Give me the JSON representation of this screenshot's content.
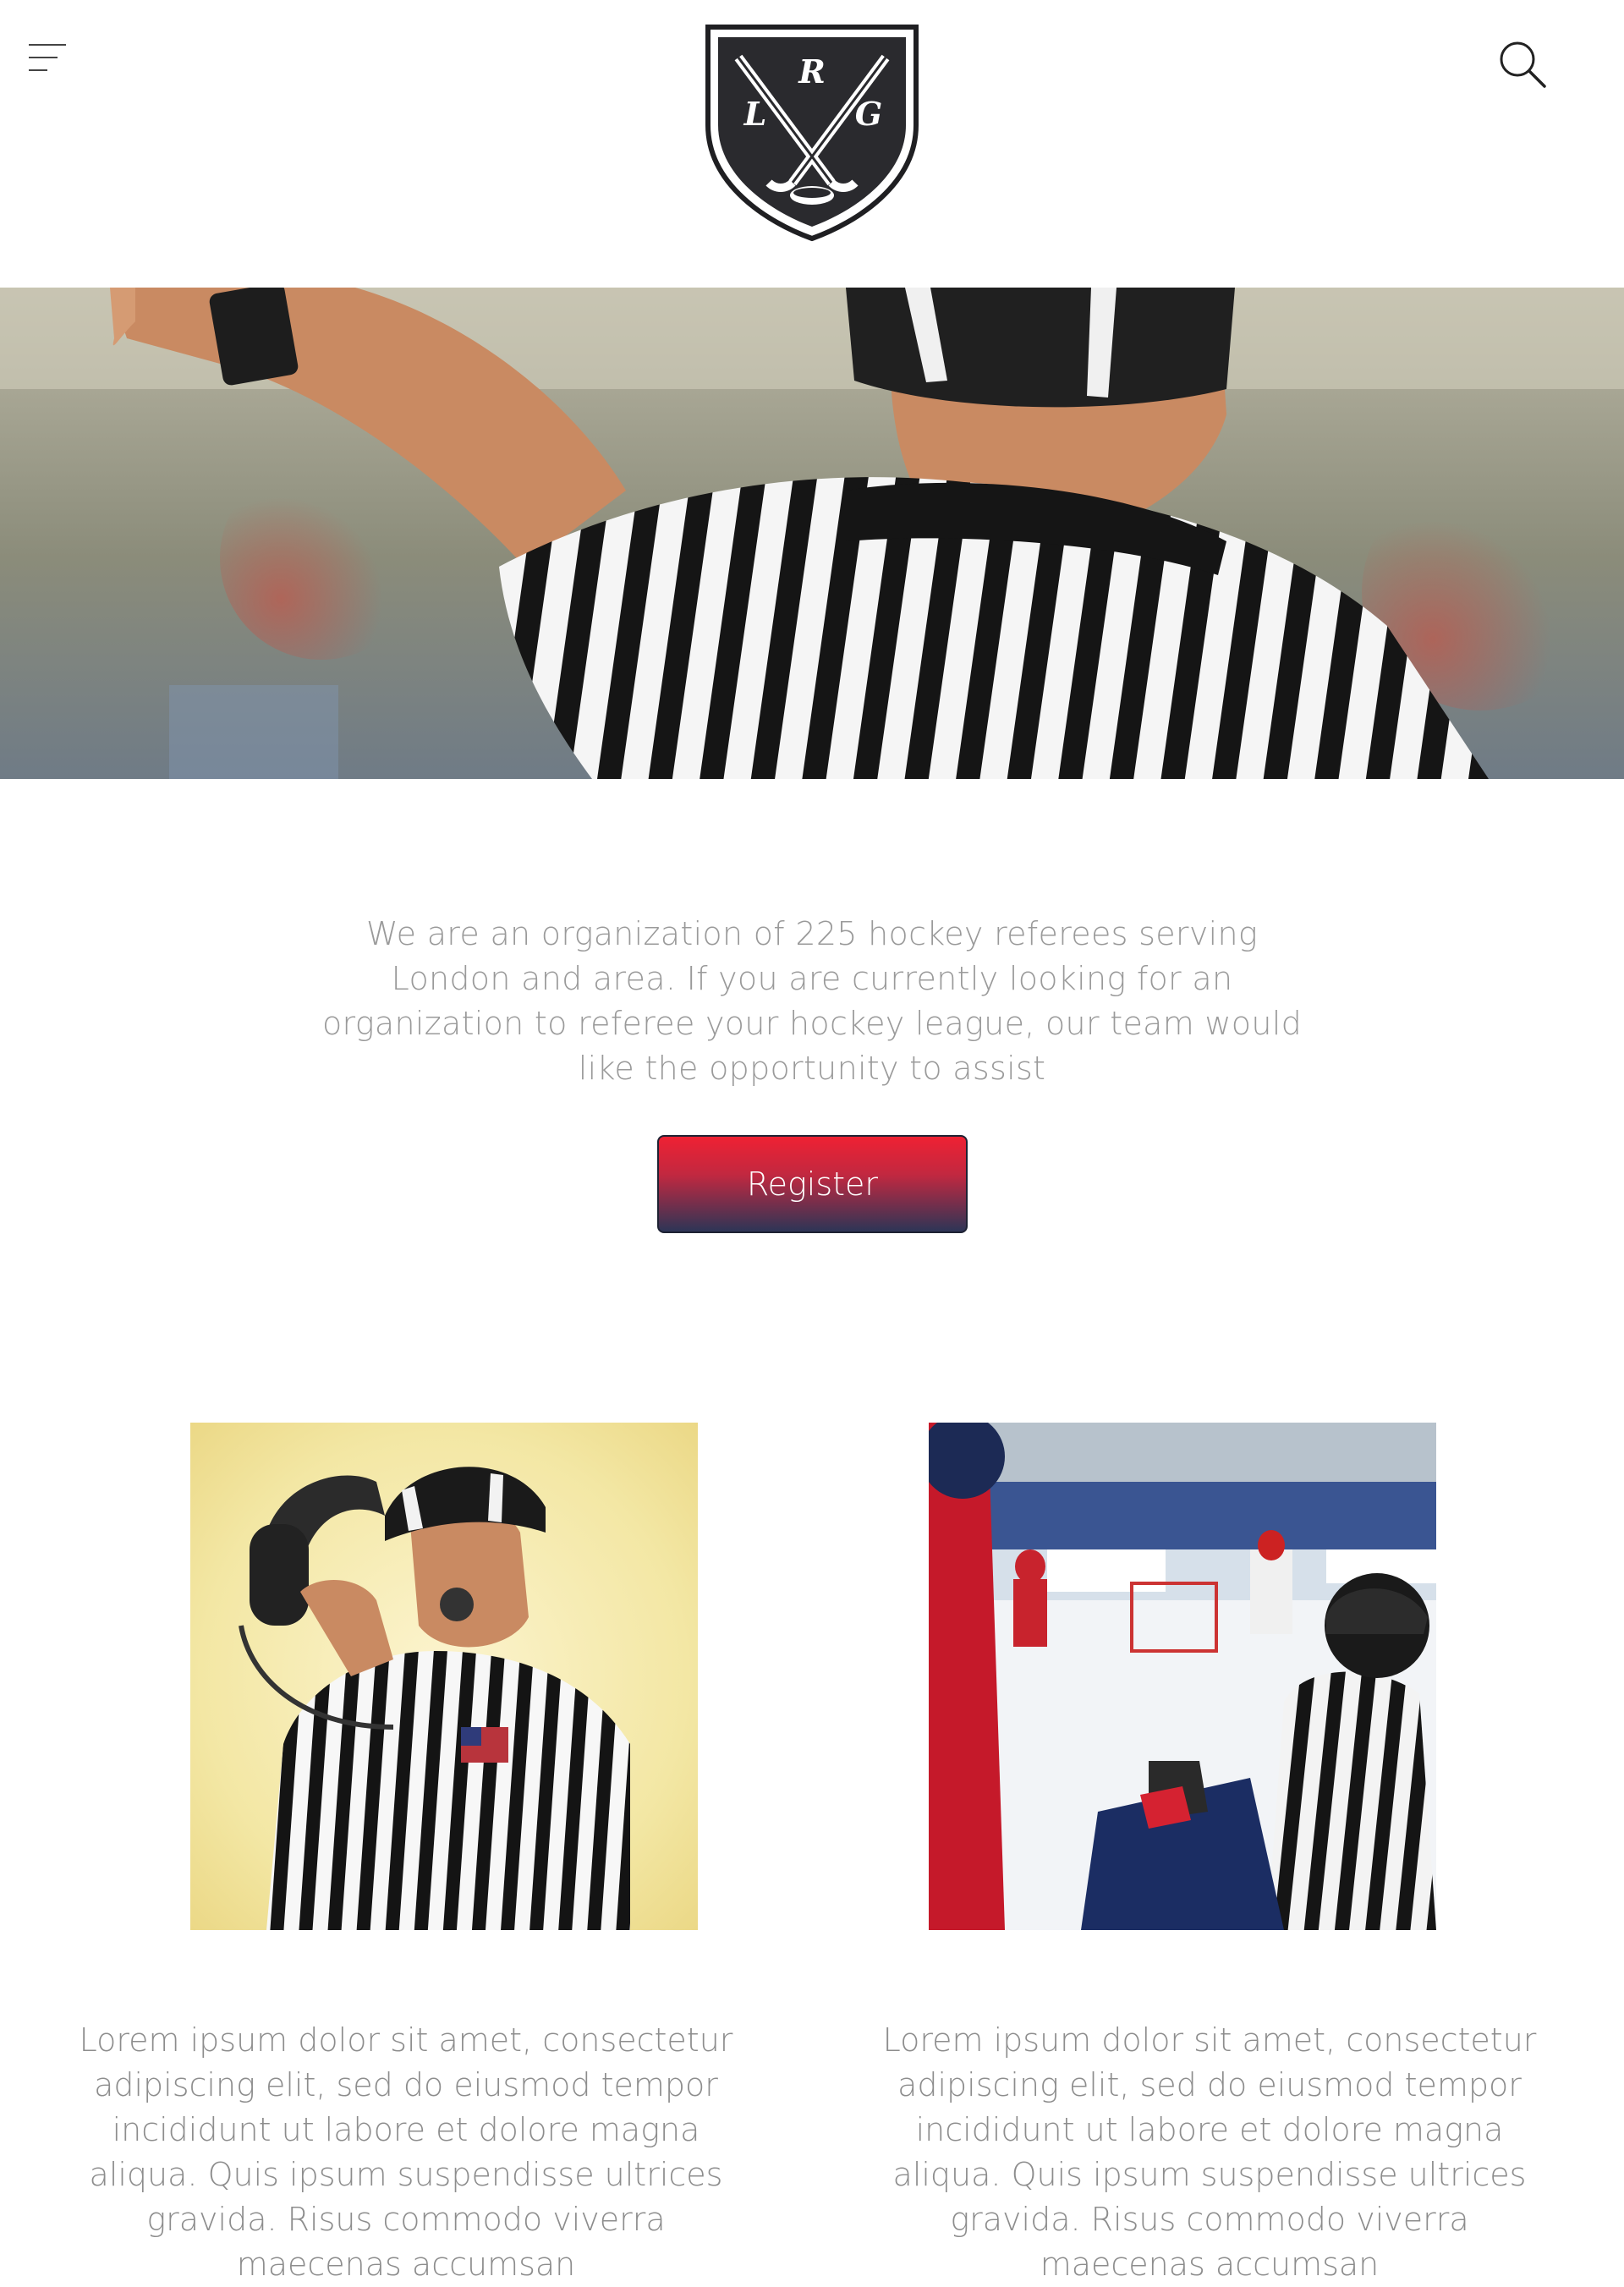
{
  "header": {
    "menu_icon": "hamburger-menu-icon",
    "search_icon": "search-icon",
    "logo": {
      "letters": [
        "R",
        "L",
        "G"
      ]
    }
  },
  "hero": {
    "image": "referee-pointing-photo"
  },
  "intro": {
    "text": "We are an organization of 225 hockey referees serving London and area. If you are currently looking for an organization to referee your hockey league, our team would like the opportunity to assist"
  },
  "register": {
    "label": "Register"
  },
  "cards": [
    {
      "image": "referee-headset-photo",
      "text": "Lorem ipsum dolor sit amet, consectetur adipiscing elit, sed do eiusmod tempor incididunt ut labore et dolore magna aliqua. Quis ipsum suspendisse ultrices gravida. Risus commodo viverra maecenas accumsan"
    },
    {
      "image": "hockey-rink-referee-photo",
      "text": "Lorem ipsum dolor sit amet, consectetur adipiscing elit, sed do eiusmod tempor incididunt ut labore et dolore magna aliqua. Quis ipsum suspendisse ultrices gravida. Risus commodo viverra maecenas accumsan"
    }
  ],
  "colors": {
    "button_top": "#ef2133",
    "button_bottom": "#2d3556",
    "text": "#9a9a9a",
    "logo": "#1f1f22"
  }
}
